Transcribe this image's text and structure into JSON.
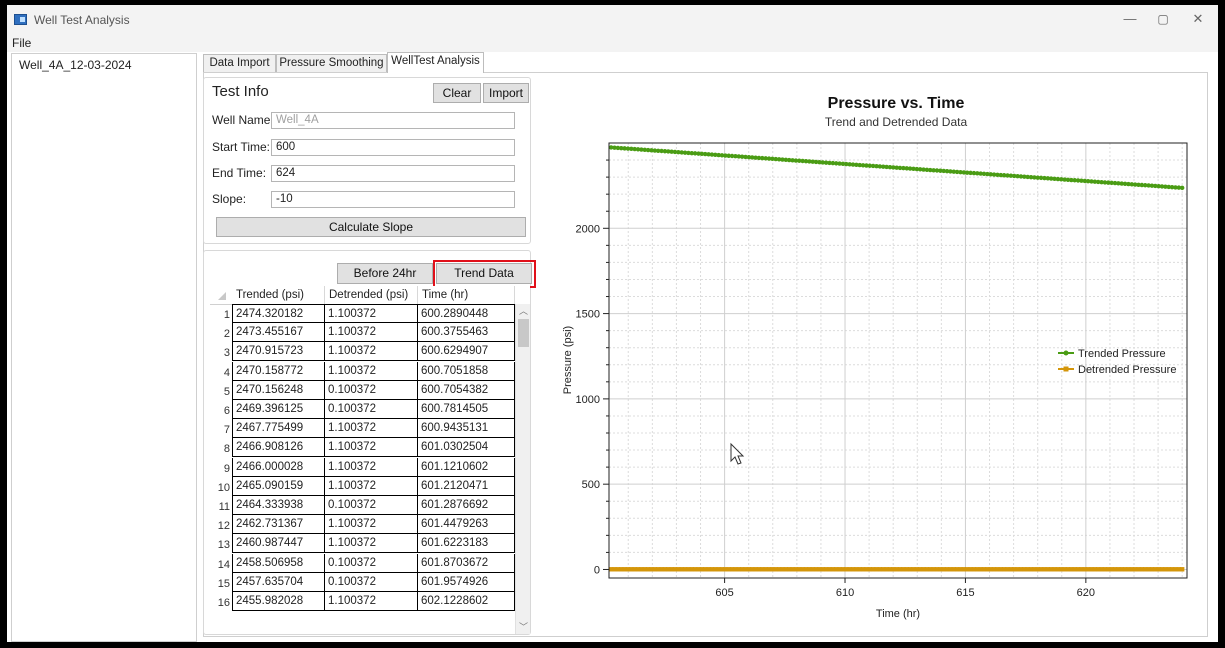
{
  "window": {
    "title": "Well Test Analysis",
    "min_glyph": "—",
    "max_glyph": "▢",
    "close_glyph": "✕"
  },
  "menu": {
    "file": "File"
  },
  "sidebar": {
    "items": [
      {
        "label": "Well_4A_12-03-2024"
      }
    ]
  },
  "tabs": [
    {
      "label": "Data Import"
    },
    {
      "label": "Pressure Smoothing"
    },
    {
      "label": "WellTest Analysis",
      "active": true
    }
  ],
  "test_info": {
    "title": "Test Info",
    "clear_label": "Clear",
    "import_label": "Import",
    "well_name_label": "Well Name:",
    "well_name_value": "Well_4A",
    "start_time_label": "Start Time:",
    "start_time_value": "600",
    "end_time_label": "End Time:",
    "end_time_value": "624",
    "slope_label": "Slope:",
    "slope_value": "-10",
    "calc_slope_label": "Calculate Slope"
  },
  "table_buttons": {
    "before_label": "Before 24hr",
    "trend_label": "Trend Data"
  },
  "table": {
    "columns": [
      "Trended (psi)",
      "Detrended (psi)",
      "Time (hr)"
    ],
    "rows": [
      [
        "1",
        "2474.320182",
        "1.100372",
        "600.2890448"
      ],
      [
        "2",
        "2473.455167",
        "1.100372",
        "600.3755463"
      ],
      [
        "3",
        "2470.915723",
        "1.100372",
        "600.6294907"
      ],
      [
        "4",
        "2470.158772",
        "1.100372",
        "600.7051858"
      ],
      [
        "5",
        "2470.156248",
        "0.100372",
        "600.7054382"
      ],
      [
        "6",
        "2469.396125",
        "0.100372",
        "600.7814505"
      ],
      [
        "7",
        "2467.775499",
        "1.100372",
        "600.9435131"
      ],
      [
        "8",
        "2466.908126",
        "1.100372",
        "601.0302504"
      ],
      [
        "9",
        "2466.000028",
        "1.100372",
        "601.1210602"
      ],
      [
        "10",
        "2465.090159",
        "1.100372",
        "601.2120471"
      ],
      [
        "11",
        "2464.333938",
        "0.100372",
        "601.2876692"
      ],
      [
        "12",
        "2462.731367",
        "1.100372",
        "601.4479263"
      ],
      [
        "13",
        "2460.987447",
        "1.100372",
        "601.6223183"
      ],
      [
        "14",
        "2458.506958",
        "0.100372",
        "601.8703672"
      ],
      [
        "15",
        "2457.635704",
        "0.100372",
        "601.9574926"
      ],
      [
        "16",
        "2455.982028",
        "1.100372",
        "602.1228602"
      ]
    ]
  },
  "colors": {
    "trended": "#4a9c14",
    "detrended": "#d4960a",
    "highlight": "#e0101a"
  },
  "chart_data": {
    "type": "line",
    "title": "Pressure vs. Time",
    "subtitle": "Trend and Detrended Data",
    "xlabel": "Time (hr)",
    "ylabel": "Pressure (psi)",
    "xlim": [
      600.2,
      624.2
    ],
    "ylim": [
      -50,
      2500
    ],
    "xticks": [
      605,
      610,
      615,
      620
    ],
    "yticks": [
      0,
      500,
      1000,
      1500,
      2000
    ],
    "grid": true,
    "legend": "right",
    "series": [
      {
        "name": "Trended Pressure",
        "x": [
          600.29,
          624.0
        ],
        "y": [
          2474,
          2237
        ]
      },
      {
        "name": "Detrended Pressure",
        "x": [
          600.29,
          624.0
        ],
        "y": [
          1.1,
          1.1
        ]
      }
    ]
  }
}
